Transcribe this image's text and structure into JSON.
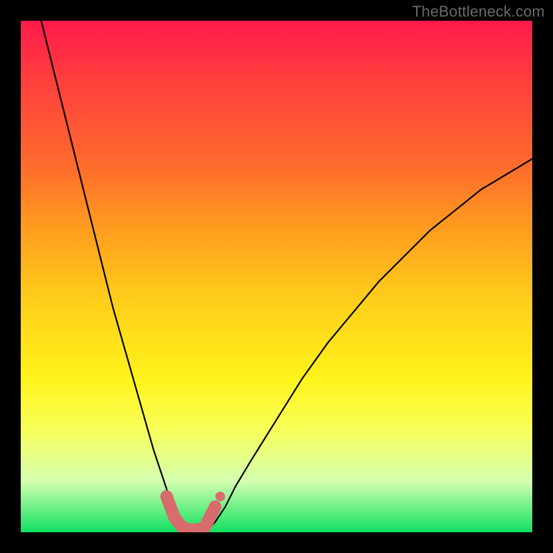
{
  "watermark": "TheBottleneck.com",
  "chart_data": {
    "type": "line",
    "title": "",
    "xlabel": "",
    "ylabel": "",
    "xlim": [
      0,
      100
    ],
    "ylim": [
      0,
      100
    ],
    "series": [
      {
        "name": "bottleneck-curve",
        "x": [
          4,
          6,
          8,
          10,
          12,
          14,
          16,
          18,
          20,
          22,
          24,
          26,
          27,
          28,
          29,
          30,
          31,
          32,
          33,
          34,
          35,
          36,
          37,
          38,
          40,
          42,
          45,
          50,
          55,
          60,
          65,
          70,
          75,
          80,
          85,
          90,
          95,
          100
        ],
        "y": [
          100,
          92,
          84,
          76,
          68,
          60,
          52,
          44,
          37,
          30,
          23,
          16,
          13,
          10,
          7,
          4,
          2,
          1,
          0.5,
          0.5,
          0.5,
          0.5,
          1,
          2,
          5,
          9,
          14,
          22,
          30,
          37,
          43,
          49,
          54,
          59,
          63,
          67,
          70,
          73
        ]
      }
    ],
    "markers": [
      {
        "name": "left-shoulder",
        "x": 28.5,
        "y": 7
      },
      {
        "name": "left-knee",
        "x": 30,
        "y": 3
      },
      {
        "name": "trough-left",
        "x": 31.5,
        "y": 1
      },
      {
        "name": "trough-mid-l",
        "x": 33,
        "y": 0.5
      },
      {
        "name": "trough-mid-r",
        "x": 34.5,
        "y": 0.5
      },
      {
        "name": "trough-right",
        "x": 36,
        "y": 1
      },
      {
        "name": "right-shoulder",
        "x": 38,
        "y": 5
      }
    ],
    "colors": {
      "curve": "#000000",
      "marker_fill": "#d86b6b",
      "gradient_top": "#ff1a4b",
      "gradient_bottom": "#10e060"
    }
  }
}
